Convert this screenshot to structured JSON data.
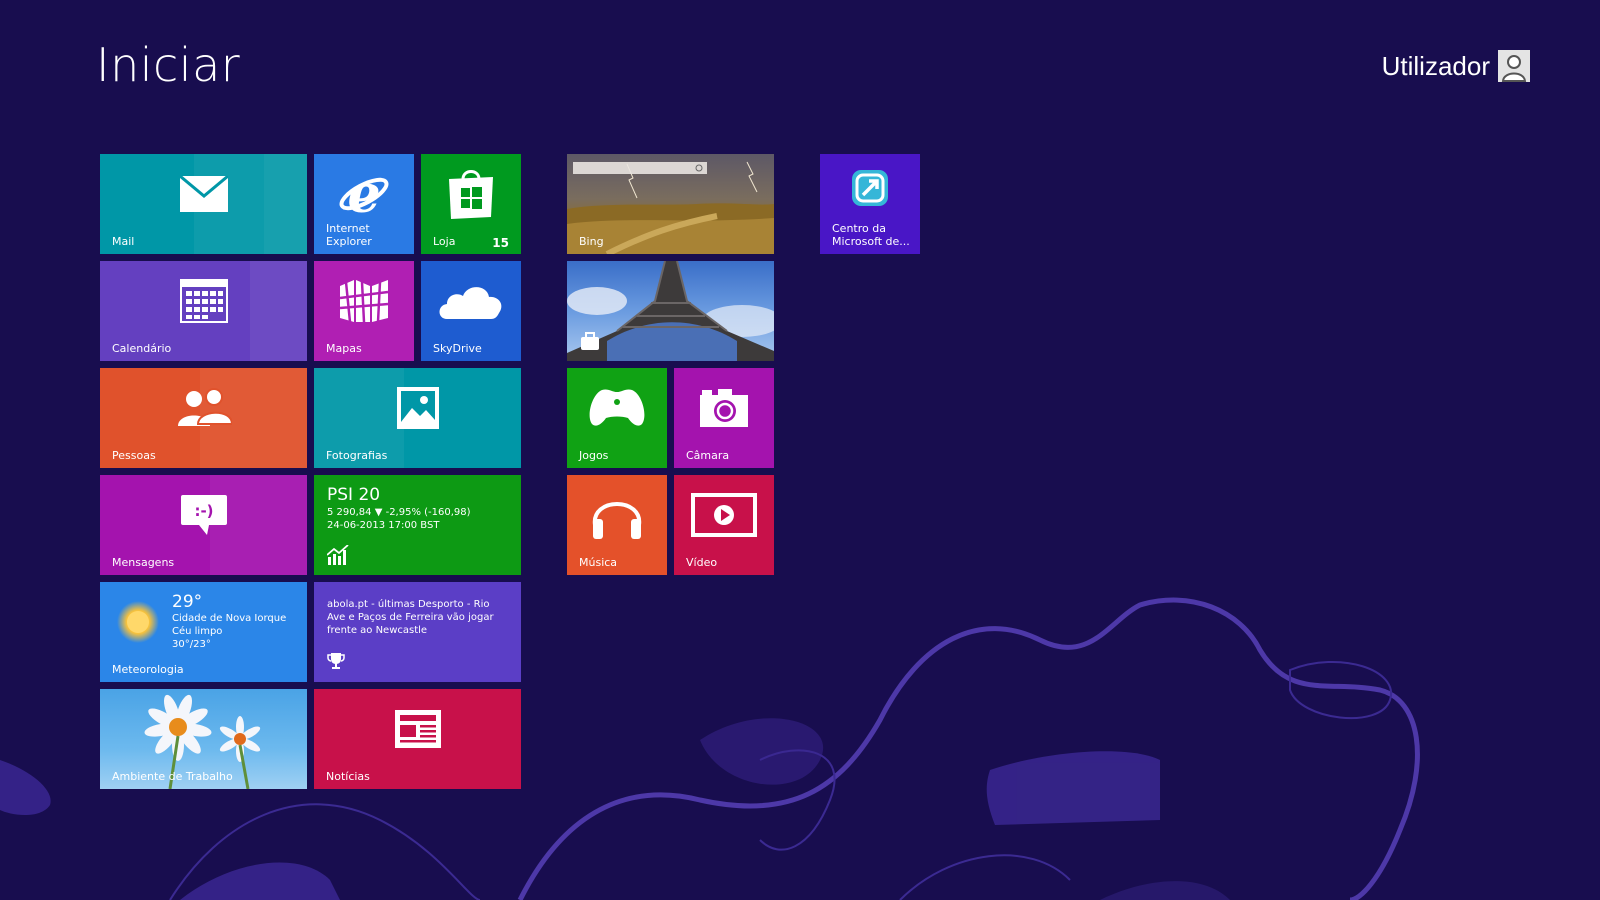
{
  "screen": {
    "title": "Iniciar",
    "user_name": "Utilizador"
  },
  "tiles": {
    "mail": {
      "label": "Mail",
      "color": "#0097a7"
    },
    "ie": {
      "label": "Internet Explorer",
      "color": "#2a7ae4"
    },
    "store": {
      "label": "Loja",
      "badge": "15",
      "color": "#009a1f"
    },
    "bing": {
      "label": "Bing"
    },
    "travel": {
      "label": ""
    },
    "centro": {
      "label": "Centro da Microsoft de...",
      "color": "#4916c6"
    },
    "calendar": {
      "label": "Calendário",
      "color": "#6440c0"
    },
    "maps": {
      "label": "Mapas",
      "color": "#b01fb3"
    },
    "skydrive": {
      "label": "SkyDrive",
      "color": "#1e5cd0"
    },
    "people": {
      "label": "Pessoas",
      "color": "#e0522c"
    },
    "photos": {
      "label": "Fotografias",
      "color": "#0097a7"
    },
    "games": {
      "label": "Jogos",
      "color": "#10a214"
    },
    "camera": {
      "label": "Câmara",
      "color": "#a413ae"
    },
    "messaging": {
      "label": "Mensagens",
      "color": "#a413ae"
    },
    "finance": {
      "index": "PSI 20",
      "quote": "5 290,84  ▼ -2,95% (-160,98)",
      "date": "24-06-2013 17:00 BST",
      "color": "#0d9a14"
    },
    "music": {
      "label": "Música",
      "color": "#e4512a"
    },
    "video": {
      "label": "Vídeo",
      "color": "#c8114a"
    },
    "weather": {
      "label": "Meteorologia",
      "temp": "29°",
      "city": "Cidade de Nova Iorque",
      "condition": "Céu limpo",
      "range": "30°/23°",
      "color": "#2b86e8"
    },
    "sports": {
      "headline": "abola.pt - últimas Desporto - Rio Ave e Paços de Ferreira vão jogar frente ao Newcastle",
      "color": "#5b3ec6"
    },
    "desktop": {
      "label": "Ambiente de Trabalho"
    },
    "news": {
      "label": "Notícias",
      "color": "#c8114a"
    }
  }
}
